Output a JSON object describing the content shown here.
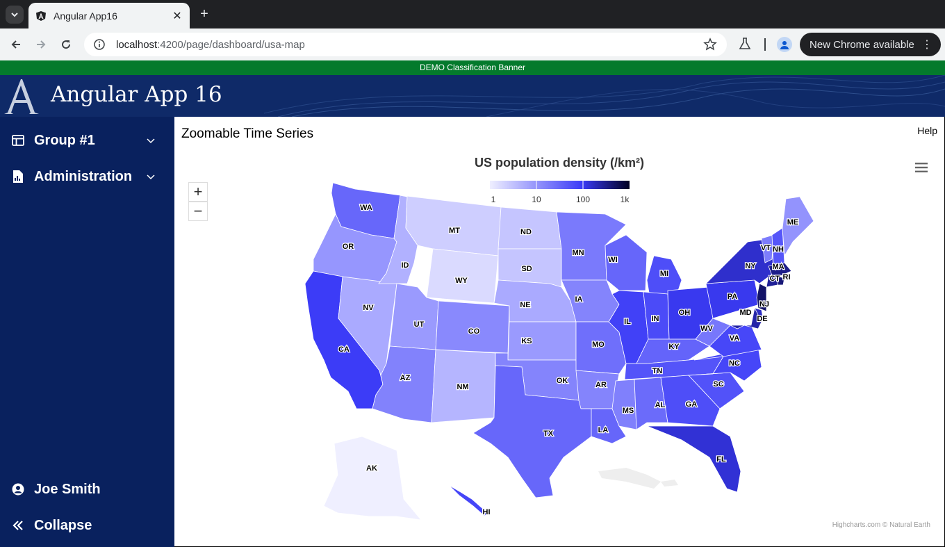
{
  "browser": {
    "tab_title": "Angular App16",
    "url_host": "localhost",
    "url_path": ":4200/page/dashboard/usa-map",
    "update_label": "New Chrome available"
  },
  "banner": {
    "text": "DEMO Classification Banner"
  },
  "app": {
    "title": "Angular App 16"
  },
  "sidebar": {
    "items": [
      {
        "label": "Group #1",
        "icon": "dashboard-icon"
      },
      {
        "label": "Administration",
        "icon": "report-icon"
      }
    ],
    "user": {
      "label": "Joe Smith",
      "icon": "account-circle-icon"
    },
    "collapse": {
      "label": "Collapse",
      "icon": "double-chevron-left-icon"
    }
  },
  "main": {
    "page_title": "Zoomable Time Series",
    "help_label": "Help"
  },
  "chart_data": {
    "type": "choropleth-map",
    "title": "US population density (/km²)",
    "color_axis": {
      "scale": "logarithmic",
      "min": 1,
      "max": 1000,
      "tick_labels": [
        "1",
        "10",
        "100",
        "1k"
      ],
      "min_color": "#efefff",
      "max_color": "#000022"
    },
    "credits": "Highcharts.com © Natural Earth",
    "states": [
      {
        "code": "WA",
        "value": 40
      },
      {
        "code": "OR",
        "value": 15
      },
      {
        "code": "CA",
        "value": 97
      },
      {
        "code": "NV",
        "value": 10
      },
      {
        "code": "ID",
        "value": 8
      },
      {
        "code": "MT",
        "value": 3
      },
      {
        "code": "WY",
        "value": 2
      },
      {
        "code": "UT",
        "value": 14
      },
      {
        "code": "AZ",
        "value": 23
      },
      {
        "code": "CO",
        "value": 20
      },
      {
        "code": "NM",
        "value": 7
      },
      {
        "code": "ND",
        "value": 4
      },
      {
        "code": "SD",
        "value": 4
      },
      {
        "code": "NE",
        "value": 10
      },
      {
        "code": "KS",
        "value": 14
      },
      {
        "code": "OK",
        "value": 22
      },
      {
        "code": "TX",
        "value": 40
      },
      {
        "code": "MN",
        "value": 27
      },
      {
        "code": "IA",
        "value": 22
      },
      {
        "code": "MO",
        "value": 34
      },
      {
        "code": "AR",
        "value": 22
      },
      {
        "code": "LA",
        "value": 41
      },
      {
        "code": "WI",
        "value": 41
      },
      {
        "code": "IL",
        "value": 89
      },
      {
        "code": "MI",
        "value": 67
      },
      {
        "code": "IN",
        "value": 72
      },
      {
        "code": "OH",
        "value": 109
      },
      {
        "code": "KY",
        "value": 43
      },
      {
        "code": "TN",
        "value": 60
      },
      {
        "code": "MS",
        "value": 24
      },
      {
        "code": "AL",
        "value": 37
      },
      {
        "code": "GA",
        "value": 68
      },
      {
        "code": "FL",
        "value": 145
      },
      {
        "code": "SC",
        "value": 62
      },
      {
        "code": "NC",
        "value": 80
      },
      {
        "code": "VA",
        "value": 78
      },
      {
        "code": "WV",
        "value": 29
      },
      {
        "code": "PA",
        "value": 110
      },
      {
        "code": "NY",
        "value": 159
      },
      {
        "code": "VT",
        "value": 26
      },
      {
        "code": "NH",
        "value": 57
      },
      {
        "code": "ME",
        "value": 16
      },
      {
        "code": "MA",
        "value": 328
      },
      {
        "code": "CT",
        "value": 286
      },
      {
        "code": "RI",
        "value": 394
      },
      {
        "code": "NJ",
        "value": 470
      },
      {
        "code": "DE",
        "value": 178
      },
      {
        "code": "MD",
        "value": 236
      },
      {
        "code": "AK",
        "value": 1
      },
      {
        "code": "HI",
        "value": 82
      }
    ]
  }
}
